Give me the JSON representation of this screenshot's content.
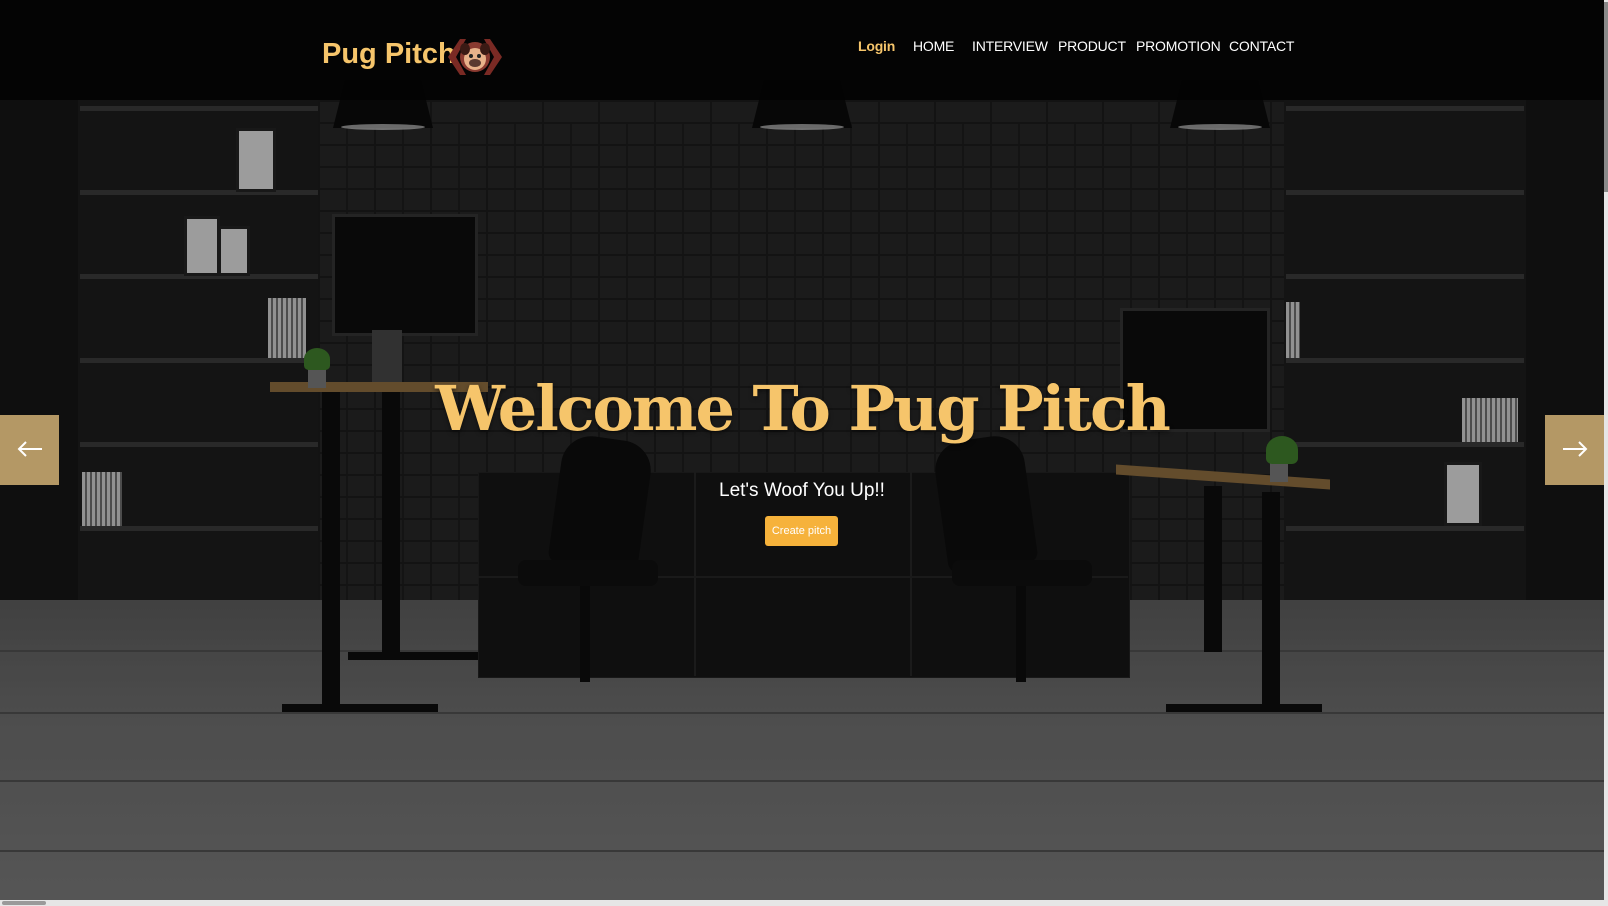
{
  "brand": {
    "name": "Pug Pitch",
    "logo_icon": "pug-face-icon",
    "colors": {
      "accent": "#f6c56b",
      "button": "#f6b23b",
      "arrow_bg": "#d1b074"
    }
  },
  "nav": {
    "items": [
      {
        "label": "Login",
        "active": true
      },
      {
        "label": "HOME"
      },
      {
        "label": "INTERVIEW"
      },
      {
        "label": "PRODUCT"
      },
      {
        "label": "PROMOTION"
      },
      {
        "label": "CONTACT"
      }
    ]
  },
  "hero": {
    "title": "Welcome To Pug Pitch",
    "subtitle": "Let's Woof You Up!!",
    "cta_label": "Create pitch"
  },
  "carousel": {
    "prev_icon": "arrow-left-icon",
    "next_icon": "arrow-right-icon"
  }
}
